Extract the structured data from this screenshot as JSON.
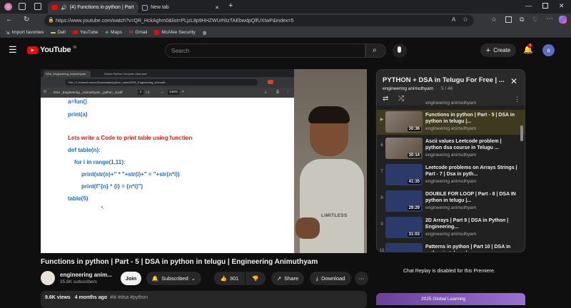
{
  "colors": {
    "accent_red": "#ff0000",
    "code_blue": "#1f6fc0",
    "code_red": "#e02020",
    "tab_active": "#35363a",
    "playlist_active": "#3e3a1e"
  },
  "browser": {
    "tabs": [
      {
        "label": "(4) Functions in python | Part",
        "icon": "youtube-icon",
        "audio_icon": "speaker-icon"
      },
      {
        "label": "New tab",
        "icon": "new-tab-icon"
      }
    ],
    "url": "https://www.youtube.com/watch?v=QR_HckAghm0&list=PLjzL8p9HHZWUrhlIzTAEbwdpQlfUXtwP&index=5",
    "favorites": [
      "Import favorites",
      "Dell",
      "YouTube",
      "Maps",
      "Gmail",
      "McAfee Security"
    ]
  },
  "yt": {
    "logo_text": "YouTube",
    "region": "IN",
    "search_placeholder": "Search",
    "create_label": "Create",
    "notif_count": "4",
    "avatar_letter": "a"
  },
  "player": {
    "inner_tabs": [
      "DSA_Engineering_Animuthyam",
      "Online Python Compiler (Interpret"
    ],
    "inner_url": "File | C:/Users/Lenovo/Downloads/python_notes/DSA_Engineering_Animuth...",
    "pdf_name": "DSA _Engineering _Animuthyam _python _5.pdf",
    "pdf_page": "2",
    "pdf_total": "/ 3",
    "pdf_zoom": "144%",
    "code_lines": [
      {
        "text": "a=fun()",
        "color": "blue"
      },
      {
        "text": "print(a)",
        "color": "blue"
      },
      {
        "text": "Lets write a Code to print table using function",
        "color": "red"
      },
      {
        "text": "def table(n):",
        "color": "blue"
      },
      {
        "text": "for i in range(1,11):",
        "color": "blue"
      },
      {
        "text": "print(str(n)+\" * \"+str(i)+\" = \"+str(n*i))",
        "color": "blue"
      },
      {
        "text": "print(f\"{n} * {i} = {n*i}\")",
        "color": "blue"
      },
      {
        "text": "table(5)",
        "color": "blue"
      }
    ],
    "shirt_text": "LIMITLESS"
  },
  "video": {
    "title": "Functions in python | Part - 5 | DSA in python in telugu | Engineering Animuthyam",
    "channel": "engineering anim...",
    "subscribers": "35.8K subscribers",
    "join_label": "Join",
    "subscribed_label": "Subscribed",
    "likes": "301",
    "share_label": "Share",
    "download_label": "Download",
    "views": "9.6K views",
    "age": "4 months ago",
    "tags": "#iit #dsa #python"
  },
  "playlist": {
    "title": "PYTHON + DSA in Telugu For Free | ...",
    "channel": "engineering animuthyam",
    "position": "5 / 46",
    "items": [
      {
        "idx": "",
        "title": "",
        "channel": "engineering animuthyam",
        "duration": ""
      },
      {
        "idx": "▶",
        "title": "Functions in python | Part - 5 | DSA in python in telugu |...",
        "channel": "engineering animuthyam",
        "duration": "30:36"
      },
      {
        "idx": "6",
        "title": "Ascii values Leetcode problem | python dsa course in Telugu ...",
        "channel": "engineering animuthyam",
        "duration": "30:14"
      },
      {
        "idx": "7",
        "title": "Leetcode problems on Arrays Strings | Part - 7 | Dsa in pyth...",
        "channel": "engineering animuthyam",
        "duration": "41:35"
      },
      {
        "idx": "8",
        "title": "DOUBLE FOR LOOP | Part - 8 | DSA IN python in telugu |...",
        "channel": "engineering animuthyam",
        "duration": "29:29"
      },
      {
        "idx": "9",
        "title": "2D Arrays | Part 9 | DSA in Python | Engineering...",
        "channel": "engineering animuthyam",
        "duration": "31:03"
      },
      {
        "idx": "10",
        "title": "Patterns in python | Part 10 | DSA in python in telugu |...",
        "channel": "",
        "duration": ""
      }
    ],
    "chat_replay": "Chat Replay is disabled for this Premiere.",
    "ad_text": "2025 Global Learning"
  }
}
